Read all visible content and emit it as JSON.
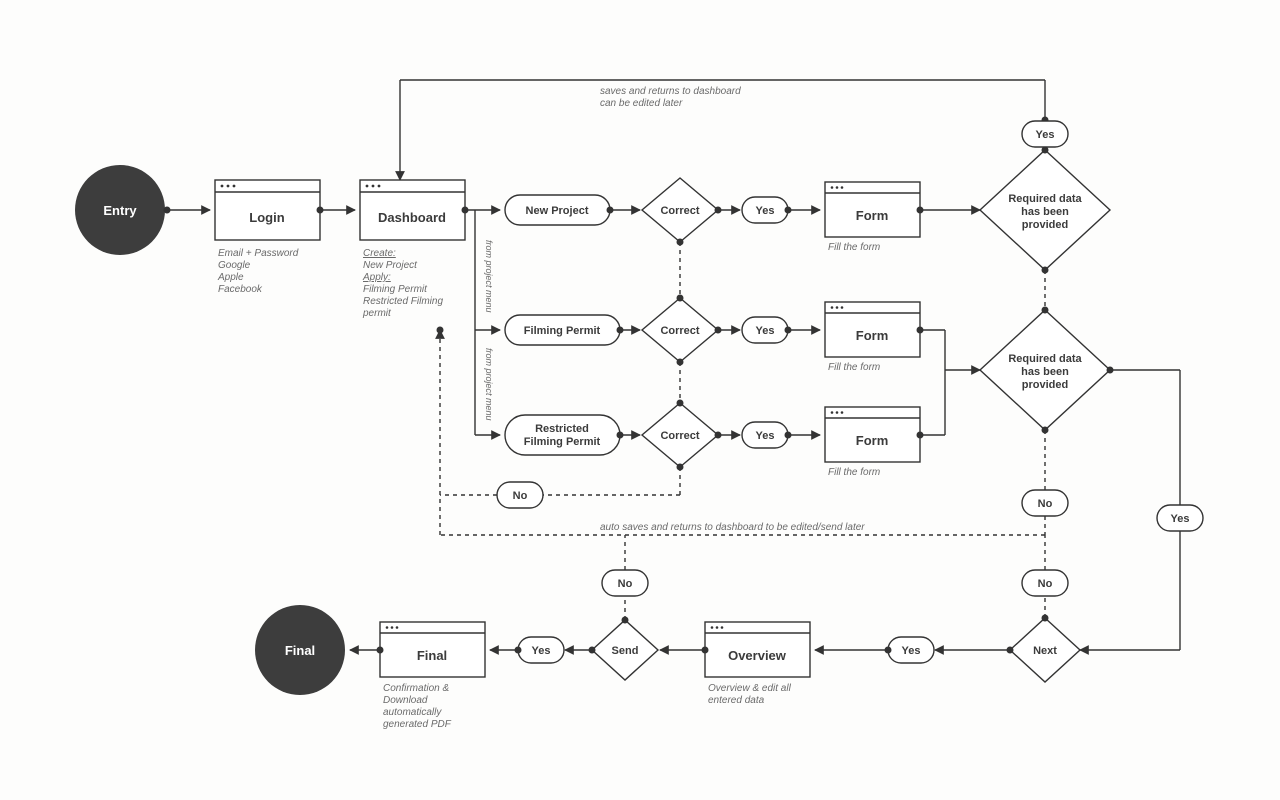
{
  "nodes": {
    "entry": "Entry",
    "final": "Final",
    "login": "Login",
    "dashboard": "Dashboard",
    "new_project": "New Project",
    "filming_permit": "Filming Permit",
    "restricted_filming_permit_l1": "Restricted",
    "restricted_filming_permit_l2": "Filming Permit",
    "correct": "Correct",
    "yes": "Yes",
    "no": "No",
    "form": "Form",
    "required_l1": "Required data",
    "required_l2": "has been",
    "required_l3": "provided",
    "next": "Next",
    "overview": "Overview",
    "send": "Send",
    "final_screen": "Final"
  },
  "captions": {
    "login_1": "Email + Password",
    "login_2": "Google",
    "login_3": "Apple",
    "login_4": "Facebook",
    "dash_h1": "Create:",
    "dash_1": "New Project",
    "dash_h2": "Apply:",
    "dash_2": "Filming Permit",
    "dash_3": "Restricted Filming",
    "dash_4": "permit",
    "form_fill": "Fill the form",
    "overview_1": "Overview & edit all",
    "overview_2": "entered data",
    "final_1": "Confirmation &",
    "final_2": "Download",
    "final_3": "automatically",
    "final_4": "generated PDF",
    "top_note_1": "saves and returns to dashboard",
    "top_note_2": "can be edited later",
    "mid_note": "auto saves and returns to dashboard to be edited/send later",
    "from_menu": "from project menu"
  }
}
